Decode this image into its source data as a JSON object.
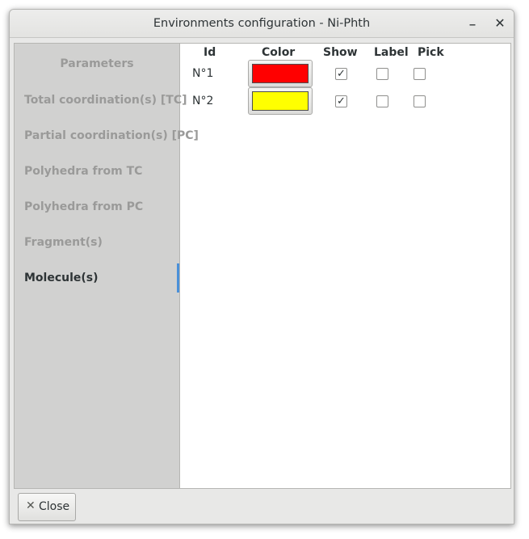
{
  "window": {
    "title": "Environments configuration - Ni-Phth",
    "minimize_glyph": "_",
    "close_glyph": "✕"
  },
  "sidebar": {
    "header": "Parameters",
    "items": [
      {
        "label": "Total coordination(s) [TC]",
        "active": false
      },
      {
        "label": "Partial coordination(s) [PC]",
        "active": false
      },
      {
        "label": "Polyhedra from TC",
        "active": false
      },
      {
        "label": "Polyhedra from PC",
        "active": false
      },
      {
        "label": "Fragment(s)",
        "active": false
      },
      {
        "label": "Molecule(s)",
        "active": true
      }
    ]
  },
  "table": {
    "headers": {
      "id": "Id",
      "color": "Color",
      "show": "Show",
      "label": "Label",
      "pick": "Pick"
    },
    "rows": [
      {
        "id": "N°1",
        "color": "#ff0000",
        "show": true,
        "label": false,
        "pick": false
      },
      {
        "id": "N°2",
        "color": "#ffff00",
        "show": true,
        "label": false,
        "pick": false
      }
    ]
  },
  "footer": {
    "close_icon": "close-icon",
    "close_label": "Close"
  },
  "colors": {
    "accent": "#4a90d9",
    "sidebar_bg": "#d1d1d0"
  }
}
